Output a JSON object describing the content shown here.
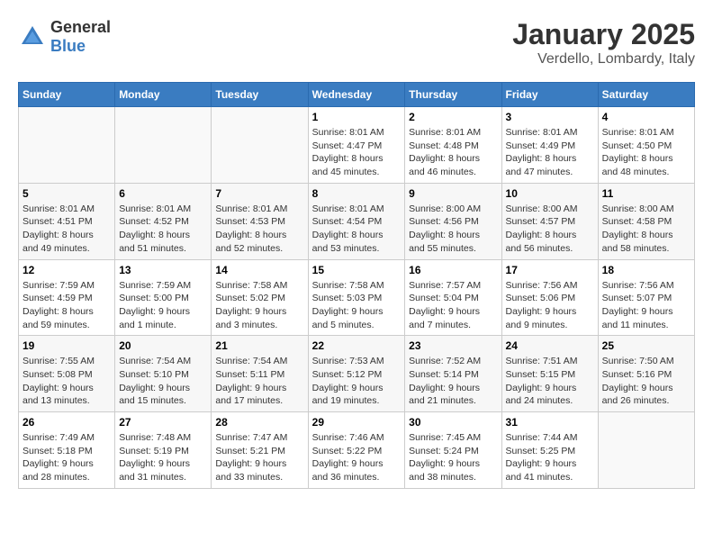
{
  "logo": {
    "text_general": "General",
    "text_blue": "Blue"
  },
  "header": {
    "month": "January 2025",
    "location": "Verdello, Lombardy, Italy"
  },
  "columns": [
    "Sunday",
    "Monday",
    "Tuesday",
    "Wednesday",
    "Thursday",
    "Friday",
    "Saturday"
  ],
  "weeks": [
    [
      {
        "day": "",
        "info": ""
      },
      {
        "day": "",
        "info": ""
      },
      {
        "day": "",
        "info": ""
      },
      {
        "day": "1",
        "info": "Sunrise: 8:01 AM\nSunset: 4:47 PM\nDaylight: 8 hours and 45 minutes."
      },
      {
        "day": "2",
        "info": "Sunrise: 8:01 AM\nSunset: 4:48 PM\nDaylight: 8 hours and 46 minutes."
      },
      {
        "day": "3",
        "info": "Sunrise: 8:01 AM\nSunset: 4:49 PM\nDaylight: 8 hours and 47 minutes."
      },
      {
        "day": "4",
        "info": "Sunrise: 8:01 AM\nSunset: 4:50 PM\nDaylight: 8 hours and 48 minutes."
      }
    ],
    [
      {
        "day": "5",
        "info": "Sunrise: 8:01 AM\nSunset: 4:51 PM\nDaylight: 8 hours and 49 minutes."
      },
      {
        "day": "6",
        "info": "Sunrise: 8:01 AM\nSunset: 4:52 PM\nDaylight: 8 hours and 51 minutes."
      },
      {
        "day": "7",
        "info": "Sunrise: 8:01 AM\nSunset: 4:53 PM\nDaylight: 8 hours and 52 minutes."
      },
      {
        "day": "8",
        "info": "Sunrise: 8:01 AM\nSunset: 4:54 PM\nDaylight: 8 hours and 53 minutes."
      },
      {
        "day": "9",
        "info": "Sunrise: 8:00 AM\nSunset: 4:56 PM\nDaylight: 8 hours and 55 minutes."
      },
      {
        "day": "10",
        "info": "Sunrise: 8:00 AM\nSunset: 4:57 PM\nDaylight: 8 hours and 56 minutes."
      },
      {
        "day": "11",
        "info": "Sunrise: 8:00 AM\nSunset: 4:58 PM\nDaylight: 8 hours and 58 minutes."
      }
    ],
    [
      {
        "day": "12",
        "info": "Sunrise: 7:59 AM\nSunset: 4:59 PM\nDaylight: 8 hours and 59 minutes."
      },
      {
        "day": "13",
        "info": "Sunrise: 7:59 AM\nSunset: 5:00 PM\nDaylight: 9 hours and 1 minute."
      },
      {
        "day": "14",
        "info": "Sunrise: 7:58 AM\nSunset: 5:02 PM\nDaylight: 9 hours and 3 minutes."
      },
      {
        "day": "15",
        "info": "Sunrise: 7:58 AM\nSunset: 5:03 PM\nDaylight: 9 hours and 5 minutes."
      },
      {
        "day": "16",
        "info": "Sunrise: 7:57 AM\nSunset: 5:04 PM\nDaylight: 9 hours and 7 minutes."
      },
      {
        "day": "17",
        "info": "Sunrise: 7:56 AM\nSunset: 5:06 PM\nDaylight: 9 hours and 9 minutes."
      },
      {
        "day": "18",
        "info": "Sunrise: 7:56 AM\nSunset: 5:07 PM\nDaylight: 9 hours and 11 minutes."
      }
    ],
    [
      {
        "day": "19",
        "info": "Sunrise: 7:55 AM\nSunset: 5:08 PM\nDaylight: 9 hours and 13 minutes."
      },
      {
        "day": "20",
        "info": "Sunrise: 7:54 AM\nSunset: 5:10 PM\nDaylight: 9 hours and 15 minutes."
      },
      {
        "day": "21",
        "info": "Sunrise: 7:54 AM\nSunset: 5:11 PM\nDaylight: 9 hours and 17 minutes."
      },
      {
        "day": "22",
        "info": "Sunrise: 7:53 AM\nSunset: 5:12 PM\nDaylight: 9 hours and 19 minutes."
      },
      {
        "day": "23",
        "info": "Sunrise: 7:52 AM\nSunset: 5:14 PM\nDaylight: 9 hours and 21 minutes."
      },
      {
        "day": "24",
        "info": "Sunrise: 7:51 AM\nSunset: 5:15 PM\nDaylight: 9 hours and 24 minutes."
      },
      {
        "day": "25",
        "info": "Sunrise: 7:50 AM\nSunset: 5:16 PM\nDaylight: 9 hours and 26 minutes."
      }
    ],
    [
      {
        "day": "26",
        "info": "Sunrise: 7:49 AM\nSunset: 5:18 PM\nDaylight: 9 hours and 28 minutes."
      },
      {
        "day": "27",
        "info": "Sunrise: 7:48 AM\nSunset: 5:19 PM\nDaylight: 9 hours and 31 minutes."
      },
      {
        "day": "28",
        "info": "Sunrise: 7:47 AM\nSunset: 5:21 PM\nDaylight: 9 hours and 33 minutes."
      },
      {
        "day": "29",
        "info": "Sunrise: 7:46 AM\nSunset: 5:22 PM\nDaylight: 9 hours and 36 minutes."
      },
      {
        "day": "30",
        "info": "Sunrise: 7:45 AM\nSunset: 5:24 PM\nDaylight: 9 hours and 38 minutes."
      },
      {
        "day": "31",
        "info": "Sunrise: 7:44 AM\nSunset: 5:25 PM\nDaylight: 9 hours and 41 minutes."
      },
      {
        "day": "",
        "info": ""
      }
    ]
  ]
}
